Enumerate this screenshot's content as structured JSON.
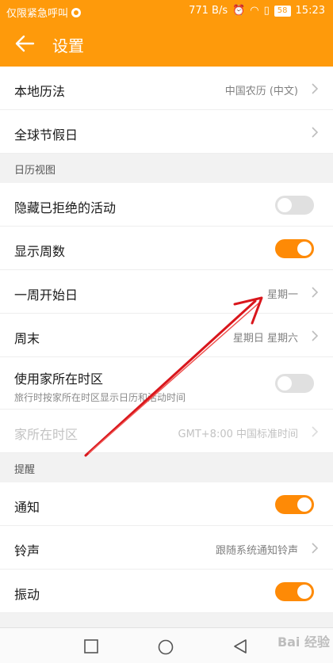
{
  "status_bar": {
    "carrier": "仅限紧急呼叫",
    "speed": "771 B/s",
    "battery": "58",
    "time": "15:23"
  },
  "app_bar": {
    "title": "设置"
  },
  "rows_top": [
    {
      "label": "本地历法",
      "value": "中国农历 (中文)"
    },
    {
      "label": "全球节假日",
      "value": ""
    }
  ],
  "calendar_section": {
    "title": "日历视图",
    "hide_declined": {
      "label": "隐藏已拒绝的活动",
      "on": false
    },
    "show_week_numbers": {
      "label": "显示周数",
      "on": true
    },
    "week_start": {
      "label": "一周开始日",
      "value": "星期一"
    },
    "weekend": {
      "label": "周末",
      "value": "星期日 星期六"
    },
    "home_tz": {
      "label": "使用家所在时区",
      "sub": "旅行时按家所在时区显示日历和活动时间",
      "on": false
    },
    "home_tz_value": {
      "label": "家所在时区",
      "value": "GMT+8:00 中国标准时间"
    }
  },
  "reminder_section": {
    "title": "提醒",
    "notify": {
      "label": "通知",
      "on": true
    },
    "ringtone": {
      "label": "铃声",
      "value": "跟随系统通知铃声"
    },
    "vibrate": {
      "label": "振动",
      "on": true
    }
  },
  "watermark": "Bai 经验",
  "colors": {
    "accent": "#fe9a0b",
    "toggle_on": "#fe8a06",
    "annotation_arrow": "#d9161c"
  }
}
